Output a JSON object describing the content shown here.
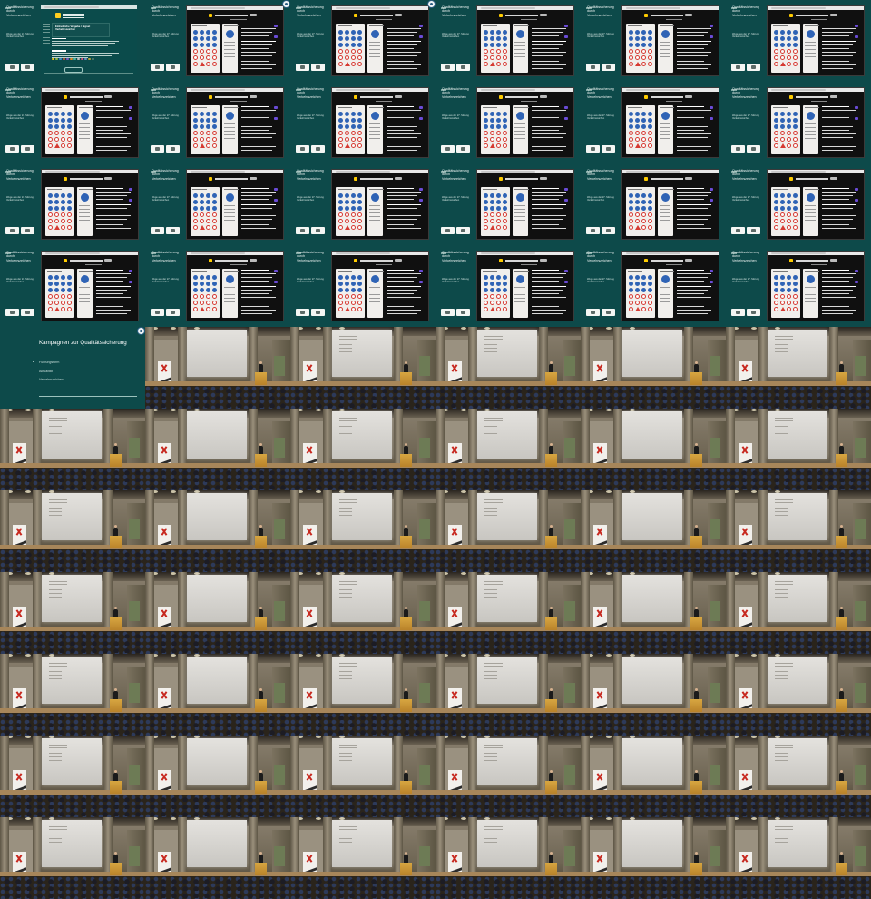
{
  "slide_text": {
    "title": "Qualitätssicherung durch Verkehrszeichen",
    "subtitle": "Wege aus der 27. Sitzung Verkehrszeichen",
    "first_frame_heading": "Einheitliche Vergabe / Signet Verkehrszeichen",
    "first_frame_button": "Zur Übersicht"
  },
  "menu": {
    "title": "Kampagnen zur Qualitätssicherung",
    "items": [
      "Führungsform",
      "Aktualität",
      "Verkehrszeichen"
    ]
  },
  "colors": {
    "slide_bg": "#0d4a4a",
    "accent_yellow": "#ffcc00",
    "sign_blue": "#2f63b5",
    "sign_red": "#d63a32",
    "chip_purple": "#6a4bd6",
    "lectern": "#d7a641"
  },
  "icons": {
    "corner_badge": "circular-badge-icon",
    "banner_logo": "red-x-logo-icon"
  }
}
